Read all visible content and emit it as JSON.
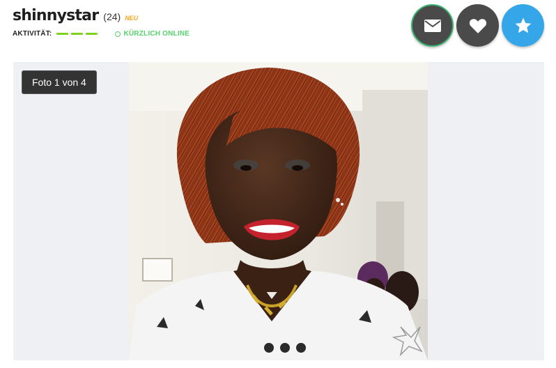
{
  "profile": {
    "username": "shinnystar",
    "age": "(24)",
    "badge": "NEU",
    "activity_label": "AKTIVITÄT:",
    "online_status": "KÜRZLICH ONLINE"
  },
  "actions": [
    {
      "name": "message",
      "icon": "envelope-icon"
    },
    {
      "name": "like",
      "icon": "heart-icon"
    },
    {
      "name": "favorite",
      "icon": "star-icon"
    }
  ],
  "gallery": {
    "counter": "Foto 1 von 4",
    "current_photo": 1,
    "total_photos": 4,
    "visible_dots": 3
  },
  "colors": {
    "activity_green": "#7ed321",
    "online_green": "#55d26b",
    "badge_orange": "#f5a623",
    "favorite_blue": "#35a6e8",
    "button_dark": "#4a4a4a"
  }
}
